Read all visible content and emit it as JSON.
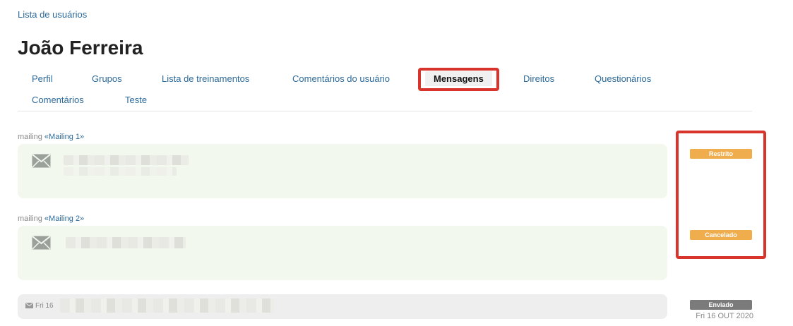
{
  "breadcrumb": "Lista de usuários",
  "title": "João Ferreira",
  "tabs": [
    "Perfil",
    "Grupos",
    "Lista de treinamentos",
    "Comentários do usuário",
    "Mensagens",
    "Direitos",
    "Questionários",
    "Comentários",
    "Teste"
  ],
  "active_tab": "Mensagens",
  "messages": [
    {
      "prefix": "mailing",
      "link": "«Mailing 1»",
      "status": "Restrito",
      "icon": "envelope-icon"
    },
    {
      "prefix": "mailing",
      "link": "«Mailing 2»",
      "status": "Cancelado",
      "icon": "envelope-icon"
    }
  ],
  "sent": {
    "date_short": "Fri 16",
    "status": "Enviado",
    "date_full": "Fri 16 OUT 2020",
    "icon": "envelope-small-icon"
  },
  "colors": {
    "link": "#2d6a9a",
    "highlight": "#d9342b",
    "card_bg": "#f3f8ef",
    "badge_warn": "#f0ad4e",
    "badge_gray": "#7b7b7b"
  }
}
